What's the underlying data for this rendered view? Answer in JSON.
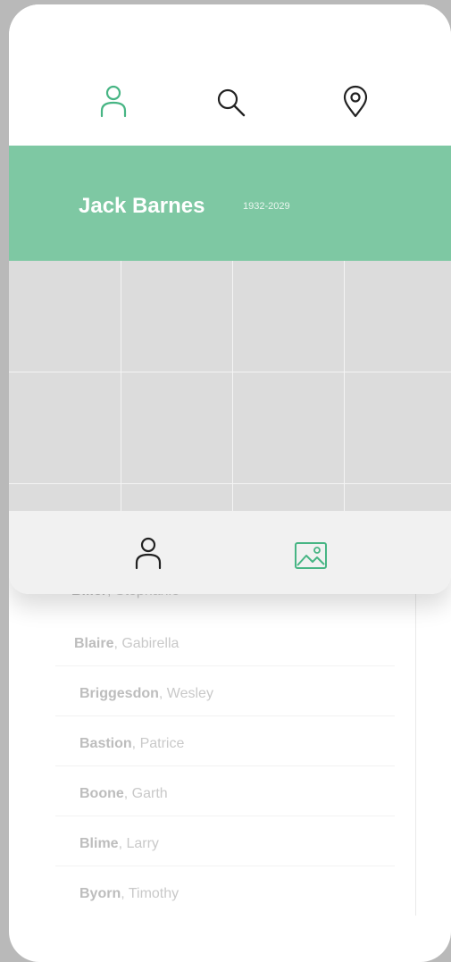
{
  "profile": {
    "name": "Jack Barnes",
    "years": "1932-2029"
  },
  "top_nav": {
    "icons": [
      "person-icon",
      "search-icon",
      "location-pin-icon"
    ],
    "active": "person-icon",
    "active_color": "#47b584",
    "inactive_color": "#222222"
  },
  "bottom_nav": {
    "icons": [
      "person-icon",
      "image-icon"
    ],
    "active": "image-icon"
  },
  "banner_color": "#7ec8a3",
  "names": [
    {
      "last": "Bliler",
      "first": ", Stephanie"
    },
    {
      "last": "Blaire",
      "first": ", Gabirella"
    },
    {
      "last": "Briggesdon",
      "first": ", Wesley"
    },
    {
      "last": "Bastion",
      "first": ", Patrice"
    },
    {
      "last": "Boone",
      "first": ", Garth"
    },
    {
      "last": "Blime",
      "first": ", Larry"
    },
    {
      "last": "Byorn",
      "first": ", Timothy"
    }
  ]
}
